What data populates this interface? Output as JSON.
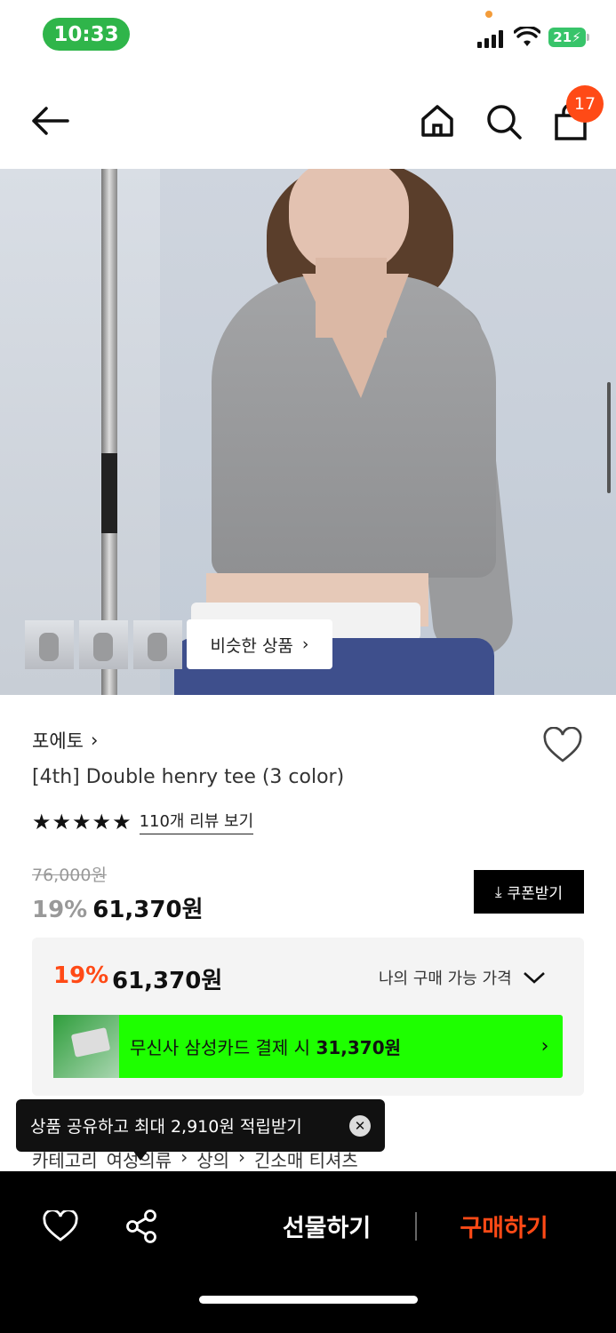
{
  "status_bar": {
    "time": "10:33",
    "battery": "21"
  },
  "header": {
    "cart_count": "17"
  },
  "gallery": {
    "similar_label": "비슷한 상품"
  },
  "product": {
    "brand": "포에토",
    "title": "[4th] Double henry tee (3 color)",
    "rating_stars": "★★★★★",
    "review_link": "110개 리뷰 보기",
    "original_price": "76,000원",
    "discount": "19%",
    "sale_price": "61,370원",
    "coupon_label": "쿠폰받기"
  },
  "price_box": {
    "discount": "19%",
    "price": "61,370원",
    "dropdown_label": "나의 구매 가능 가격",
    "card_text": "무신사 삼성카드 결제 시",
    "card_price": "31,370원"
  },
  "category": {
    "label": "카테고리",
    "path": [
      "여성의류",
      "상의",
      "긴소매 티셔츠"
    ]
  },
  "tooltip": {
    "text": "상품 공유하고 최대 2,910원 적립받기"
  },
  "bottom_bar": {
    "gift_label": "선물하기",
    "buy_label": "구매하기"
  },
  "colors": {
    "accent": "#ff4a16",
    "card_green": "#1eff00",
    "time_pill": "#2fb54a"
  }
}
